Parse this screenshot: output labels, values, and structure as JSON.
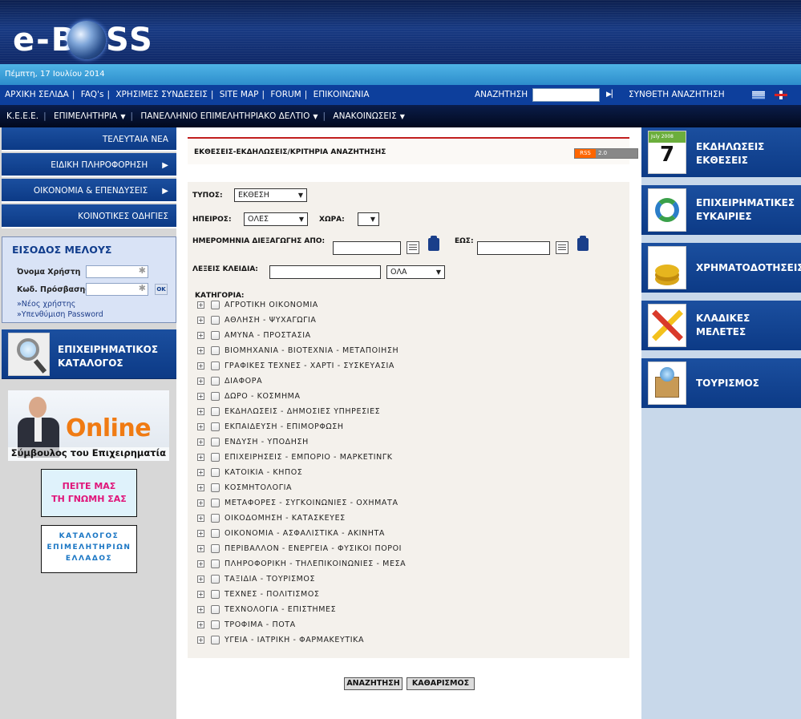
{
  "header": {
    "logo_left": "e-B",
    "logo_right": "SS",
    "date": "Πέμπτη, 17 Ιουλίου 2014"
  },
  "nav1": {
    "links": [
      "ΑΡΧΙΚΗ ΣΕΛΙΔΑ",
      "FAQ's",
      "ΧΡΗΣΙΜΕΣ ΣΥΝΔΕΣΕΙΣ",
      "SITE MAP",
      "FORUM",
      "ΕΠΙΚΟΙΝΩΝΙΑ"
    ],
    "search_label": "ΑΝΑΖΗΤΗΣΗ",
    "search_value": "",
    "advanced": "ΣΥΝΘΕΤΗ ΑΝΑΖΗΤΗΣΗ",
    "flags": [
      "greek-flag-icon",
      "uk-flag-icon"
    ]
  },
  "nav2": {
    "items": [
      "Κ.Ε.Ε.Ε.",
      "ΕΠΙΜΕΛΗΤΗΡΙΑ",
      "ΠΑΝΕΛΛΗΝΙΟ ΕΠΙΜΕΛΗΤΗΡΙΑΚΟ ΔΕΛΤΙΟ",
      "ΑΝΑΚΟΙΝΩΣΕΙΣ"
    ]
  },
  "left": {
    "nav": [
      "ΤΕΛΕΥΤΑΙΑ ΝΕΑ",
      "ΕΙΔΙΚΗ ΠΛΗΡΟΦΟΡΗΣΗ",
      "ΟΙΚΟΝΟΜΙΑ & ΕΠΕΝΔΥΣΕΙΣ",
      "ΚΟΙΝΟΤΙΚΕΣ ΟΔΗΓΙΕΣ"
    ],
    "login": {
      "title": "ΕΙΣΟΔΟΣ ΜΕΛΟΥΣ",
      "username_label": "Όνομα Χρήστη",
      "password_label": "Κωδ. Πρόσβασης",
      "ok": "OK",
      "new_user": "»Νέος χρήστης",
      "reminder": "»Υπενθύμιση Password"
    },
    "catalog_line1": "ΕΠΙΧΕΙΡΗΜΑΤΙΚΟΣ",
    "catalog_line2": "ΚΑΤΑΛΟΓΟΣ",
    "banner_online": "Online",
    "banner_sub": "Σύμβουλος του Επιχειρηματία",
    "opinion_line1": "ΠΕΙΤΕ ΜΑΣ",
    "opinion_line2": "ΤΗ ΓΝΩΜΗ ΣΑΣ",
    "chambers_line1": "ΚΑΤΑΛΟΓΟΣ",
    "chambers_line2": "ΕΠΙΜΕΛΗΤΗΡΙΩΝ",
    "chambers_line3": "ΕΛΛΑΔΟΣ"
  },
  "main": {
    "title": "ΕΚΘΕΣΕΙΣ-ΕΚΔΗΛΩΣΕΙΣ/ΚΡΙΤΗΡΙΑ ΑΝΑΖΗΤΗΣΗΣ",
    "rss_a": "RSS",
    "rss_b": "2.0",
    "type_label": "ΤΥΠΟΣ:",
    "type_value": "ΕΚΘΕΣΗ",
    "continent_label": "ΗΠΕΙΡΟΣ:",
    "continent_value": "ΟΛΕΣ",
    "country_label": "ΧΩΡΑ:",
    "country_value": "",
    "date_label": "ΗΜΕΡΟΜΗΝΙΑ ΔΙΕΞΑΓΩΓΗΣ ΑΠΟ:",
    "date_to_label": "ΕΩΣ:",
    "keywords_label": "ΛΕΞΕΙΣ ΚΛΕΙΔΙΑ:",
    "keywords_value": "",
    "keywords_mode": "ΟΛΑ",
    "category_label": "ΚΑΤΗΓΟΡΙΑ:",
    "categories": [
      "ΑΓΡΟΤΙΚΗ ΟΙΚΟΝΟΜΙΑ",
      "ΑΘΛΗΣΗ - ΨΥΧΑΓΩΓΙΑ",
      "ΑΜΥΝΑ - ΠΡΟΣΤΑΣΙΑ",
      "ΒΙΟΜΗΧΑΝΙΑ - ΒΙΟΤΕΧΝΙΑ - ΜΕΤΑΠΟΙΗΣΗ",
      "ΓΡΑΦΙΚΕΣ ΤΕΧΝΕΣ - ΧΑΡΤΙ - ΣΥΣΚΕΥΑΣΙΑ",
      "ΔΙΑΦΟΡΑ",
      "ΔΩΡΟ - ΚΟΣΜΗΜΑ",
      "ΕΚΔΗΛΩΣΕΙΣ - ΔΗΜΟΣΙΕΣ ΥΠΗΡΕΣΙΕΣ",
      "ΕΚΠΑΙΔΕΥΣΗ - ΕΠΙΜΟΡΦΩΣΗ",
      "ΕΝΔΥΣΗ - ΥΠΟΔΗΣΗ",
      "ΕΠΙΧΕΙΡΗΣΕΙΣ - ΕΜΠΟΡΙΟ - ΜΑΡΚΕΤΙΝΓΚ",
      "ΚΑΤΟΙΚΙΑ - ΚΗΠΟΣ",
      "ΚΟΣΜΗΤΟΛΟΓΙΑ",
      "ΜΕΤΑΦΟΡΕΣ - ΣΥΓΚΟΙΝΩΝΙΕΣ - ΟΧΗΜΑΤΑ",
      "ΟΙΚΟΔΟΜΗΣΗ - ΚΑΤΑΣΚΕΥΕΣ",
      "ΟΙΚΟΝΟΜΙΑ - ΑΣΦΑΛΙΣΤΙΚΑ - ΑΚΙΝΗΤΑ",
      "ΠΕΡΙΒΑΛΛΟΝ - ΕΝΕΡΓΕΙΑ - ΦΥΣΙΚΟΙ ΠΟΡΟΙ",
      "ΠΛΗΡΟΦΟΡΙΚΗ - ΤΗΛΕΠΙΚΟΙΝΩΝΙΕΣ - ΜΕΣΑ",
      "ΤΑΞΙΔΙΑ - ΤΟΥΡΙΣΜΟΣ",
      "ΤΕΧΝΕΣ - ΠΟΛΙΤΙΣΜΟΣ",
      "ΤΕΧΝΟΛΟΓΙΑ - ΕΠΙΣΤΗΜΕΣ",
      "ΤΡΟΦΙΜΑ - ΠΟΤΑ",
      "ΥΓΕΙΑ - ΙΑΤΡΙΚΗ - ΦΑΡΜΑΚΕΥΤΙΚΑ"
    ],
    "search_button": "ΑΝΑΖΗΤΗΣΗ",
    "clear_button": "ΚΑΘΑΡΙΣΜΟΣ"
  },
  "right": {
    "cal_month": "July",
    "cal_year": "2008",
    "cal_day": "7",
    "tiles": [
      {
        "line1": "ΕΚΔΗΛΩΣΕΙΣ",
        "line2": "ΕΚΘΕΣΕΙΣ",
        "icon": "calendar-icon"
      },
      {
        "line1": "ΕΠΙΧΕΙΡΗΜΑΤΙΚΕΣ",
        "line2": "ΕΥΚΑΙΡΙΕΣ",
        "icon": "cycle-arrows-icon"
      },
      {
        "line1": "ΧΡΗΜΑΤΟΔΟΤΗΣΕΙΣ",
        "line2": "",
        "icon": "coins-icon"
      },
      {
        "line1": "ΚΛΑΔΙΚΕΣ",
        "line2": "ΜΕΛΕΤΕΣ",
        "icon": "pencil-ruler-icon"
      },
      {
        "line1": "ΤΟΥΡΙΣΜΟΣ",
        "line2": "",
        "icon": "travel-box-icon"
      }
    ]
  }
}
